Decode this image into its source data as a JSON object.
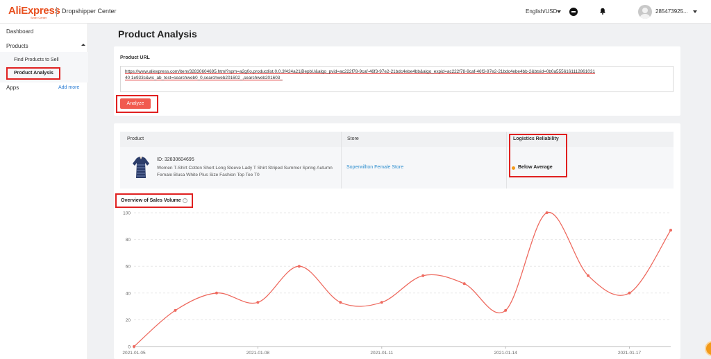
{
  "topbar": {
    "brand": "AliExpress",
    "brand_sub": "Seller Center",
    "title": "Dropshipper Center",
    "language": "English/USD",
    "user_id": "285473925..."
  },
  "sidebar": {
    "dashboard": "Dashboard",
    "products": "Products",
    "find_products": "Find Products to Sell",
    "product_analysis": "Product Analysis",
    "apps": "Apps",
    "add_more": "Add more"
  },
  "page": {
    "title": "Product Analysis"
  },
  "url_form": {
    "label": "Product URL",
    "value": "https://www.aliexpress.com/item/32830604695.html?spm=a2g0o.productlist.0.0.3f424a21jBepbU&algo_pvid=ac222f78-9caf-46f3-97e2-21bdc4ebe4bb&algo_expid=ac222f78-9caf-46f3-97e2-21bdc4ebe4bb-2&btsid=0b0a555616111286103140 1e933c&ws_ab_test=searchweb0_0,searchweb201602_,searchweb201603_",
    "button": "Analyze"
  },
  "table": {
    "headers": [
      "Product",
      "Store",
      "Logistics Reliability"
    ],
    "product_id": "ID: 32830604695",
    "product_desc": "Women T-Shirt Cotton Short Long Sleeve Lady T Shirt Striped Summer Spring Autumn Female Blusa White Plus Size Fashion Top Tee T0",
    "store": "Soperwillton Female Store",
    "logistics": "Below Average"
  },
  "sales": {
    "title": "Overview of Sales Volume",
    "help": "?"
  },
  "colors": {
    "accent": "#f15a4f",
    "line": "#ee6a5f",
    "highlight": "#e02020",
    "link": "#2f8fcf",
    "warning": "#f39a18"
  },
  "chart_data": {
    "type": "line",
    "x": [
      "2021-01-05",
      "2021-01-06",
      "2021-01-07",
      "2021-01-08",
      "2021-01-09",
      "2021-01-10",
      "2021-01-11",
      "2021-01-12",
      "2021-01-13",
      "2021-01-14",
      "2021-01-15",
      "2021-01-16",
      "2021-01-17",
      "2021-01-18"
    ],
    "series": [
      {
        "values": [
          0,
          27,
          40,
          33,
          60,
          33,
          33,
          53,
          47,
          27,
          100,
          53,
          40,
          87
        ]
      }
    ],
    "x_tick_labels": [
      "2021-01-05",
      "2021-01-08",
      "2021-01-11",
      "2021-01-14",
      "2021-01-17"
    ],
    "y_ticks": [
      0,
      20,
      40,
      60,
      80,
      100
    ],
    "ylim": [
      0,
      100
    ],
    "grid": "horizontal dashed",
    "title": "",
    "xlabel": "",
    "ylabel": ""
  }
}
